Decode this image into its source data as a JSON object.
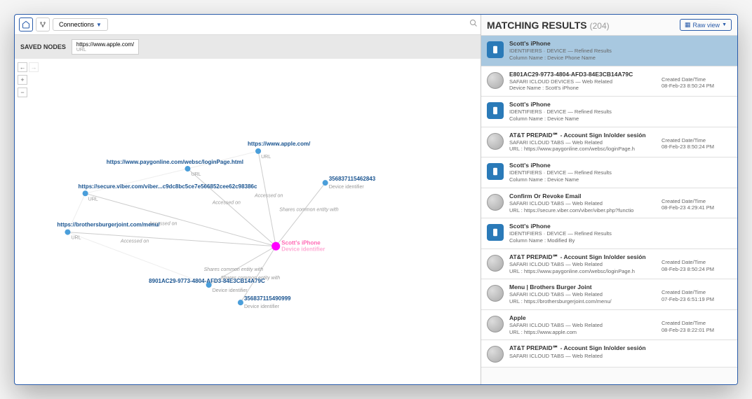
{
  "toolbar": {
    "connections_label": "Connections"
  },
  "saved_nodes": {
    "label": "SAVED NODES",
    "chip_title": "https://www.apple.com/",
    "chip_sub": "URL"
  },
  "graph": {
    "center": {
      "label": "Scott's iPhone",
      "sublabel": "Device identifier"
    },
    "nodes": [
      {
        "id": "n1",
        "label": "https://www.apple.com/",
        "sublabel": "URL"
      },
      {
        "id": "n2",
        "label": "https://www.paygonline.com/websc/loginPage.html",
        "sublabel": "URL"
      },
      {
        "id": "n3",
        "label": "https://secure.viber.com/viber...c9dc8bc5ce7e566852cee62c98386c",
        "sublabel": "URL"
      },
      {
        "id": "n4",
        "label": "https://brothersburgerjoint.com/menu/",
        "sublabel": "URL"
      },
      {
        "id": "n5",
        "label": "356837115462843",
        "sublabel": "Device identifier"
      },
      {
        "id": "n6",
        "label": "8901AC29-9773-4804-AFD3-84E3CB14A79C",
        "sublabel": "Device identifier"
      },
      {
        "id": "n7",
        "label": "356837115490999",
        "sublabel": "Device identifier"
      }
    ],
    "edge_labels": {
      "accessed": "Accessed on",
      "shares": "Shares common entity with"
    }
  },
  "results": {
    "title": "MATCHING RESULTS",
    "count": "(204)",
    "raw_view": "Raw view",
    "items": [
      {
        "icon": "device",
        "selected": true,
        "title": "Scott's iPhone",
        "line1": "IDENTIFIERS · DEVICE — Refined Results",
        "line2": "Column Name : Device Phone Name",
        "meta_label": "",
        "meta_value": ""
      },
      {
        "icon": "globe",
        "title": "E801AC29-9773-4804-AFD3-84E3CB14A79C",
        "line1": "SAFARI ICLOUD DEVICES — Web Related",
        "line2": "Device Name : Scott's iPhone",
        "meta_label": "Created Date/Time",
        "meta_value": "08-Feb-23 8:50:24 PM"
      },
      {
        "icon": "device",
        "title": "Scott's iPhone",
        "line1": "IDENTIFIERS · DEVICE — Refined Results",
        "line2": "Column Name : Device Name",
        "meta_label": "",
        "meta_value": ""
      },
      {
        "icon": "globe",
        "title": "AT&T PREPAID℠ - Account Sign In/older sesión",
        "line1": "SAFARI ICLOUD TABS — Web Related",
        "line2": "URL : https://www.paygonline.com/websc/loginPage.h",
        "meta_label": "Created Date/Time",
        "meta_value": "08-Feb-23 8:50:24 PM"
      },
      {
        "icon": "device",
        "title": "Scott's iPhone",
        "line1": "IDENTIFIERS · DEVICE — Refined Results",
        "line2": "Column Name : Device Name",
        "meta_label": "",
        "meta_value": ""
      },
      {
        "icon": "globe",
        "title": "Confirm Or Revoke Email",
        "line1": "SAFARI ICLOUD TABS — Web Related",
        "line2": "URL : https://secure.viber.com/viber/viber.php?functio",
        "meta_label": "Created Date/Time",
        "meta_value": "08-Feb-23 4:29:41 PM"
      },
      {
        "icon": "device",
        "title": "Scott's iPhone",
        "line1": "IDENTIFIERS · DEVICE — Refined Results",
        "line2": "Column Name : Modified By",
        "meta_label": "",
        "meta_value": ""
      },
      {
        "icon": "globe",
        "title": "AT&T PREPAID℠ - Account Sign In/older sesión",
        "line1": "SAFARI ICLOUD TABS — Web Related",
        "line2": "URL : https://www.paygonline.com/websc/loginPage.h",
        "meta_label": "Created Date/Time",
        "meta_value": "08-Feb-23 8:50:24 PM"
      },
      {
        "icon": "globe",
        "title": "Menu | Brothers Burger Joint",
        "line1": "SAFARI ICLOUD TABS — Web Related",
        "line2": "URL : https://brothersburgerjoint.com/menu/",
        "meta_label": "Created Date/Time",
        "meta_value": "07-Feb-23 6:51:19 PM"
      },
      {
        "icon": "globe",
        "title": "Apple",
        "line1": "SAFARI ICLOUD TABS — Web Related",
        "line2": "URL : https://www.apple.com",
        "meta_label": "Created Date/Time",
        "meta_value": "08-Feb-23 8:22:01 PM"
      },
      {
        "icon": "globe",
        "title": "AT&T PREPAID℠ - Account Sign In/older sesión",
        "line1": "SAFARI ICLOUD TABS — Web Related",
        "line2": "",
        "meta_label": "",
        "meta_value": ""
      }
    ]
  }
}
